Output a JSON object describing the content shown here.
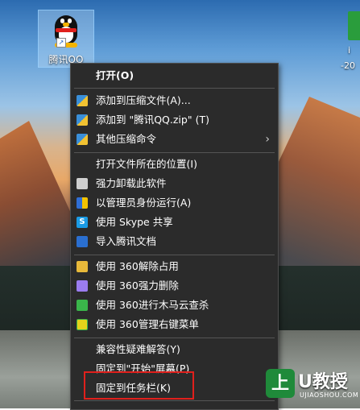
{
  "desktop": {
    "qq_icon_label": "腾讯QQ",
    "right_icon_text": "i",
    "right_icon_subtext": "-20"
  },
  "context_menu": {
    "items": [
      {
        "label": "打开(O)",
        "bold": true
      },
      {
        "label": "添加到压缩文件(A)...",
        "icon": "archive-icon"
      },
      {
        "label": "添加到 \"腾讯QQ.zip\" (T)",
        "icon": "archive-icon"
      },
      {
        "label": "其他压缩命令",
        "icon": "archive-icon",
        "submenu_arrow": "›"
      },
      {
        "label": "打开文件所在的位置(I)"
      },
      {
        "label": "强力卸载此软件",
        "icon": "trash-icon"
      },
      {
        "label": "以管理员身份运行(A)",
        "icon": "shield-icon"
      },
      {
        "label": "使用 Skype 共享",
        "icon": "skype-icon",
        "icon_text": "S"
      },
      {
        "label": "导入腾讯文档",
        "icon": "import-icon"
      },
      {
        "label": "使用 360解除占用",
        "icon": "unlock-icon"
      },
      {
        "label": "使用 360强力删除",
        "icon": "delete-icon"
      },
      {
        "label": "使用 360进行木马云查杀",
        "icon": "360-icon"
      },
      {
        "label": "使用 360管理右键菜单",
        "icon": "360-menu-icon"
      },
      {
        "label": "兼容性疑难解答(Y)"
      },
      {
        "label": "固定到\"开始\"屏幕(P)"
      },
      {
        "label": "固定到任务栏(K)"
      }
    ],
    "highlight_color": "#e0201c"
  },
  "watermark": {
    "logo_text": "上",
    "brand": "U教授",
    "domain": "UJIAOSHOU.COM"
  }
}
